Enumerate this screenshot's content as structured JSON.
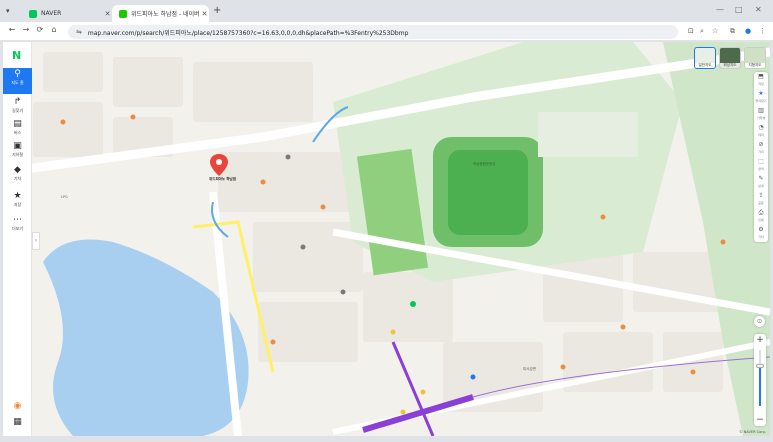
{
  "browser": {
    "tabs": [
      {
        "title": "NAVER",
        "favicon_color": "#03c75a",
        "active": false
      },
      {
        "title": "위드피아노 하남점 - 네이버 지도",
        "favicon_color": "#1ec800",
        "active": true
      }
    ],
    "url": "map.naver.com/p/search/위드피아노/place/1258757360?c=16.63,0,0,0,dh&placePath=%3Fentry%253Dbmp",
    "window_controls": [
      "—",
      "□",
      "✕"
    ]
  },
  "sidebar": {
    "logo": "N",
    "items": [
      {
        "label": "지도 홈",
        "icon": "map-pin-icon",
        "glyph": "⚲",
        "active": true
      },
      {
        "label": "길찾기",
        "icon": "route-icon",
        "glyph": "↱",
        "active": false
      },
      {
        "label": "버스",
        "icon": "bus-icon",
        "glyph": "▤",
        "active": false
      },
      {
        "label": "지하철",
        "icon": "subway-icon",
        "glyph": "▣",
        "active": false
      },
      {
        "label": "기차",
        "icon": "train-icon",
        "glyph": "◆",
        "active": false
      },
      {
        "label": "저장",
        "icon": "star-icon",
        "glyph": "★",
        "active": false
      },
      {
        "label": "더보기",
        "icon": "more-icon",
        "glyph": "⋯",
        "active": false
      }
    ],
    "footer_icons": [
      "user-avatar-icon",
      "apps-grid-icon"
    ]
  },
  "map": {
    "selected_place": {
      "name": "위드피아노 하남점",
      "pin_color": "#e8453c"
    },
    "pois": [
      {
        "text": "위드피아노 하남점"
      },
      {
        "text": "하남종합운동장"
      },
      {
        "text": "미사강변"
      },
      {
        "text": "LPG"
      },
      {
        "text": "더보기"
      }
    ],
    "layer_thumbs": [
      "일반지도",
      "위성지도",
      "지형지도"
    ],
    "right_tools": [
      {
        "icon": "save-map-icon",
        "label": "저장"
      },
      {
        "icon": "favorite-star-icon",
        "label": "즐겨찾기"
      },
      {
        "icon": "road-view-icon",
        "label": "거리뷰"
      },
      {
        "icon": "theme-icon",
        "label": "테마"
      },
      {
        "icon": "distance-icon",
        "label": "거리"
      },
      {
        "icon": "area-icon",
        "label": "면적"
      },
      {
        "icon": "radius-icon",
        "label": "반경"
      },
      {
        "icon": "share-icon",
        "label": "공유"
      },
      {
        "icon": "print-icon",
        "label": "인쇄"
      },
      {
        "icon": "misc-icon",
        "label": "기타"
      }
    ],
    "footer": "© NAVER Corp."
  },
  "colors": {
    "accent": "#1e78f0",
    "naver_green": "#03c75a",
    "park": "#c8e6c4",
    "water": "#a8cff0",
    "road_yellow": "#fff06a",
    "subway_purple": "#8a3fd6",
    "pin_red": "#e8453c"
  }
}
